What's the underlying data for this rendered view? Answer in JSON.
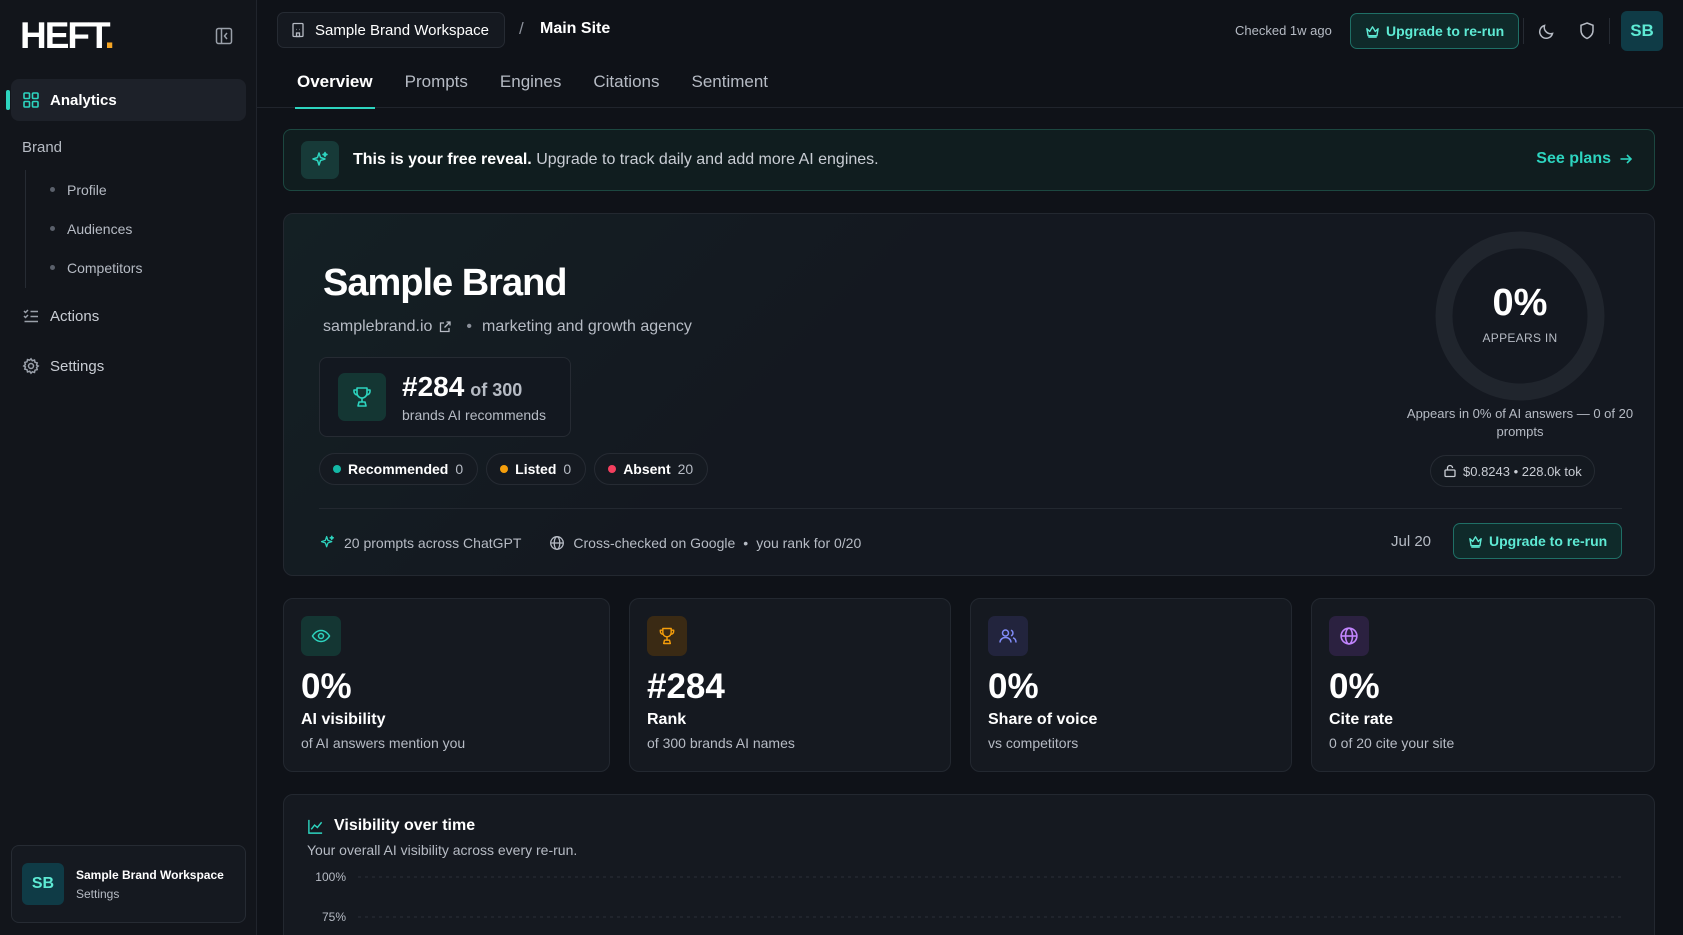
{
  "app": {
    "logo_text": "HEFT",
    "logo_dot": ".",
    "accent": "#2dd4bf",
    "logo_dot_color": "#f5a524"
  },
  "sidebar": {
    "analytics_label": "Analytics",
    "brand_group_label": "Brand",
    "brand_items": [
      {
        "label": "Profile"
      },
      {
        "label": "Audiences"
      },
      {
        "label": "Competitors"
      }
    ],
    "actions_label": "Actions",
    "settings_label": "Settings",
    "workspace": {
      "avatar": "SB",
      "name": "Sample Brand Workspace",
      "sub": "Settings"
    }
  },
  "header": {
    "workspace_name": "Sample Brand Workspace",
    "separator": "/",
    "site_name": "Main Site",
    "checked": "Checked 1w ago",
    "upgrade_label": "Upgrade to re-run",
    "avatar": "SB",
    "tabs": [
      {
        "label": "Overview",
        "active": true
      },
      {
        "label": "Prompts"
      },
      {
        "label": "Engines"
      },
      {
        "label": "Citations"
      },
      {
        "label": "Sentiment"
      }
    ]
  },
  "banner": {
    "bold": "This is your free reveal.",
    "text": " Upgrade to track daily and add more AI engines.",
    "link": "See plans"
  },
  "hero": {
    "brand_name": "Sample Brand",
    "domain": "samplebrand.io",
    "bullet": "•",
    "category": "marketing and growth agency",
    "rank": "#284",
    "rank_of": "of 300",
    "rank_sub": "brands AI recommends",
    "pills": [
      {
        "label": "Recommended",
        "value": "0",
        "color": "#14b8a6"
      },
      {
        "label": "Listed",
        "value": "0",
        "color": "#f59e0b"
      },
      {
        "label": "Absent",
        "value": "20",
        "color": "#f43f5e"
      }
    ],
    "foot_prompts": "20 prompts across ChatGPT",
    "foot_cross": "Cross-checked on Google",
    "foot_bullet": "•",
    "foot_rank": "you rank for 0/20",
    "date": "Jul 20",
    "upgrade_label": "Upgrade to re-run",
    "ring_value": "0%",
    "ring_fraction": 0,
    "ring_label": "APPEARS IN",
    "ring_desc": "Appears in 0% of AI answers — 0 of 20 prompts",
    "cost": "$0.8243 • 228.0k tok"
  },
  "stats": [
    {
      "value": "0%",
      "label": "AI visibility",
      "sub": "of AI answers mention you",
      "icon": "eye-icon",
      "color": "#2dd4bf",
      "bg": "#143633"
    },
    {
      "value": "#284",
      "label": "Rank",
      "sub": "of 300 brands AI names",
      "icon": "trophy-icon",
      "color": "#f59e0b",
      "bg": "#3a2a14"
    },
    {
      "value": "0%",
      "label": "Share of voice",
      "sub": "vs competitors",
      "icon": "users-icon",
      "color": "#818cf8",
      "bg": "#22243d"
    },
    {
      "value": "0%",
      "label": "Cite rate",
      "sub": "0 of 20 cite your site",
      "icon": "globe-icon",
      "color": "#c084fc",
      "bg": "#2b2140"
    }
  ],
  "chart": {
    "title": "Visibility over time",
    "sub": "Your overall AI visibility across every re-run."
  },
  "chart_data": {
    "type": "line",
    "title": "Visibility over time",
    "ylim": [
      0,
      100
    ],
    "y_ticks": [
      "100%",
      "75%"
    ],
    "grid": true,
    "series": []
  }
}
